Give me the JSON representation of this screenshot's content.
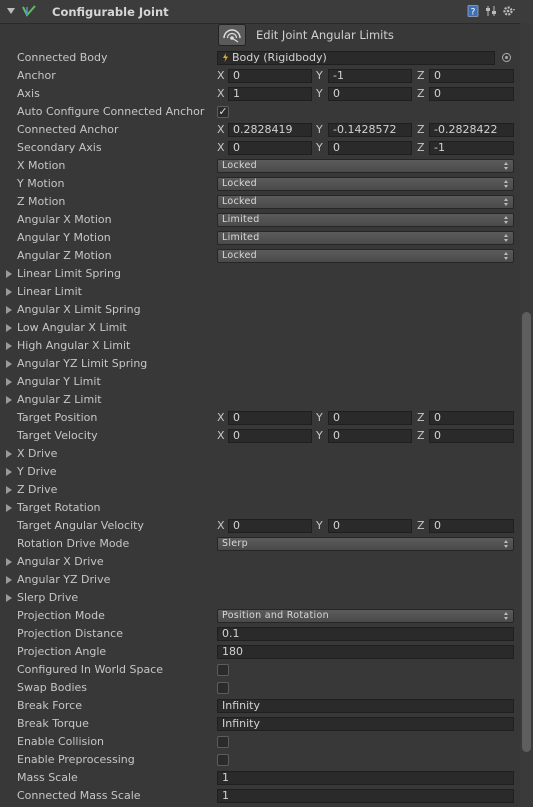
{
  "component": {
    "title": "Configurable Joint",
    "edit_label": "Edit Joint Angular Limits"
  },
  "colors": {
    "background": "#383838",
    "field": "#2a2a2a",
    "dropdown": "#535353",
    "text": "#c6c6c6"
  },
  "icons": [
    "fold-arrow-icon",
    "configurable-joint-icon",
    "help-icon",
    "preset-icon",
    "gear-icon",
    "edit-angular-limits-icon",
    "rigidbody-icon",
    "object-picker-icon",
    "dropdown-arrow-icon",
    "checkmark-icon",
    "foldout-arrow-icon"
  ],
  "rows": {
    "connected_body": {
      "label": "Connected Body",
      "value": "Body (Rigidbody)"
    },
    "anchor": {
      "label": "Anchor",
      "x": "0",
      "y": "-1",
      "z": "0"
    },
    "axis": {
      "label": "Axis",
      "x": "1",
      "y": "0",
      "z": "0"
    },
    "auto_configure": {
      "label": "Auto Configure Connected Anchor",
      "checked": true,
      "mark": "✓"
    },
    "connected_anchor": {
      "label": "Connected Anchor",
      "x": "0.2828419",
      "y": "-0.1428572",
      "z": "-0.2828422"
    },
    "secondary_axis": {
      "label": "Secondary Axis",
      "x": "0",
      "y": "0",
      "z": "-1"
    },
    "x_motion": {
      "label": "X Motion",
      "value": "Locked"
    },
    "y_motion": {
      "label": "Y Motion",
      "value": "Locked"
    },
    "z_motion": {
      "label": "Z Motion",
      "value": "Locked"
    },
    "ang_x_motion": {
      "label": "Angular X Motion",
      "value": "Limited"
    },
    "ang_y_motion": {
      "label": "Angular Y Motion",
      "value": "Limited"
    },
    "ang_z_motion": {
      "label": "Angular Z Motion",
      "value": "Locked"
    },
    "linear_limit_spring": {
      "label": "Linear Limit Spring"
    },
    "linear_limit": {
      "label": "Linear Limit"
    },
    "ang_x_limit_spring": {
      "label": "Angular X Limit Spring"
    },
    "low_ang_x_limit": {
      "label": "Low Angular X Limit"
    },
    "high_ang_x_limit": {
      "label": "High Angular X Limit"
    },
    "ang_yz_limit_spring": {
      "label": "Angular YZ Limit Spring"
    },
    "ang_y_limit": {
      "label": "Angular Y Limit"
    },
    "ang_z_limit": {
      "label": "Angular Z Limit"
    },
    "target_position": {
      "label": "Target Position",
      "x": "0",
      "y": "0",
      "z": "0"
    },
    "target_velocity": {
      "label": "Target Velocity",
      "x": "0",
      "y": "0",
      "z": "0"
    },
    "x_drive": {
      "label": "X Drive"
    },
    "y_drive": {
      "label": "Y Drive"
    },
    "z_drive": {
      "label": "Z Drive"
    },
    "target_rotation": {
      "label": "Target Rotation"
    },
    "target_ang_velocity": {
      "label": "Target Angular Velocity",
      "x": "0",
      "y": "0",
      "z": "0"
    },
    "rotation_drive_mode": {
      "label": "Rotation Drive Mode",
      "value": "Slerp"
    },
    "ang_x_drive": {
      "label": "Angular X Drive"
    },
    "ang_yz_drive": {
      "label": "Angular YZ Drive"
    },
    "slerp_drive": {
      "label": "Slerp Drive"
    },
    "projection_mode": {
      "label": "Projection Mode",
      "value": "Position and Rotation"
    },
    "projection_distance": {
      "label": "Projection Distance",
      "value": "0.1"
    },
    "projection_angle": {
      "label": "Projection Angle",
      "value": "180"
    },
    "configured_world": {
      "label": "Configured In World Space",
      "checked": false
    },
    "swap_bodies": {
      "label": "Swap Bodies",
      "checked": false
    },
    "break_force": {
      "label": "Break Force",
      "value": "Infinity"
    },
    "break_torque": {
      "label": "Break Torque",
      "value": "Infinity"
    },
    "enable_collision": {
      "label": "Enable Collision",
      "checked": false
    },
    "enable_preprocessing": {
      "label": "Enable Preprocessing",
      "checked": false
    },
    "mass_scale": {
      "label": "Mass Scale",
      "value": "1"
    },
    "connected_mass_scale": {
      "label": "Connected Mass Scale",
      "value": "1"
    }
  },
  "axis_letters": {
    "x": "X",
    "y": "Y",
    "z": "Z"
  }
}
